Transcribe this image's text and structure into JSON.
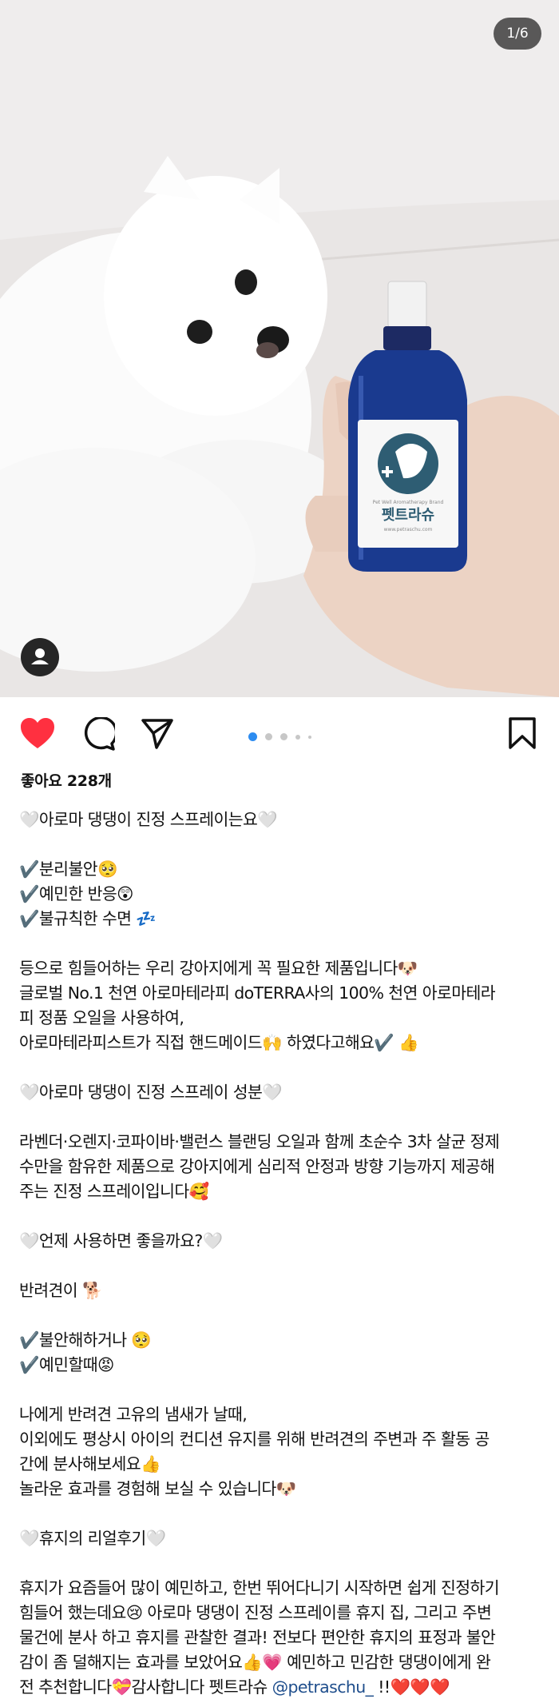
{
  "post": {
    "photo": {
      "counter": "1/6",
      "bottle_brand": "펫트라슈",
      "bottle_subtext": "Pet Well Aromatherapy Brand",
      "bottle_url": "www.petraschu.com"
    },
    "likes_label": "좋아요 228개",
    "pagination": {
      "active_index": 0,
      "count": 5
    },
    "caption_lines": [
      "🤍아로마 댕댕이 진정 스프레이는요🤍",
      "",
      "✔️분리불안🥺",
      "✔️예민한 반응😲",
      "✔️불규칙한 수면 💤",
      "",
      "등으로 힘들어하는 우리 강아지에게 꼭 필요한 제품입니다🐶",
      "글로벌 No.1 천연 아로마테라피 doTERRA사의 100% 천연 아로마테라",
      "피 정품 오일을 사용하여,",
      "아로마테라피스트가 직접 핸드메이드🙌 하였다고해요✔️ 👍",
      "",
      "🤍아로마 댕댕이 진정 스프레이 성분🤍",
      "",
      "라벤더·오렌지·코파이바·밸런스 블랜딩 오일과 함께 초순수 3차 살균 정제",
      "수만을 함유한 제품으로 강아지에게 심리적 안정과 방향 기능까지 제공해",
      "주는 진정 스프레이입니다🥰",
      "",
      "🤍언제 사용하면 좋을까요?🤍",
      "",
      "반려견이 🐕",
      "",
      "✔️불안해하거나 🥺",
      "✔️예민할때😡",
      "",
      "나에게 반려견 고유의 냄새가 날때,",
      "이외에도 평상시 아이의 컨디션 유지를 위해 반려견의 주변과 주 활동 공",
      "간에 분사해보세요👍",
      "놀라운 효과를 경험해 보실 수 있습니다🐶",
      "",
      "🤍휴지의 리얼후기🤍",
      "",
      "휴지가 요즘들어 많이 예민하고, 한번 뛰어다니기 시작하면 쉽게 진정하기",
      "힘들어 했는데요😢 아로마 댕댕이 진정 스프레이를 휴지 집, 그리고 주변",
      "물건에 분사 하고 휴지를 관찰한 결과! 전보다 편안한 휴지의 표정과 불안",
      "감이 좀 덜해지는 효과를 보았어요👍💗 예민하고 민감한 댕댕이에게 완"
    ],
    "caption_last": {
      "before": "전 추천합니다💝감사합니다 펫트라슈 ",
      "mention": "@petraschu_",
      "after": " !!❤️❤️❤️"
    }
  },
  "icons": {
    "like": "heart-filled-icon",
    "comment": "comment-bubble-icon",
    "share": "paper-plane-icon",
    "save": "bookmark-icon",
    "user_tag": "person-icon"
  },
  "colors": {
    "like_red": "#ff3040",
    "pager_active": "#2d8cf0",
    "mention_blue": "#1f4e8c",
    "bottle_blue": "#1a3a8f"
  }
}
